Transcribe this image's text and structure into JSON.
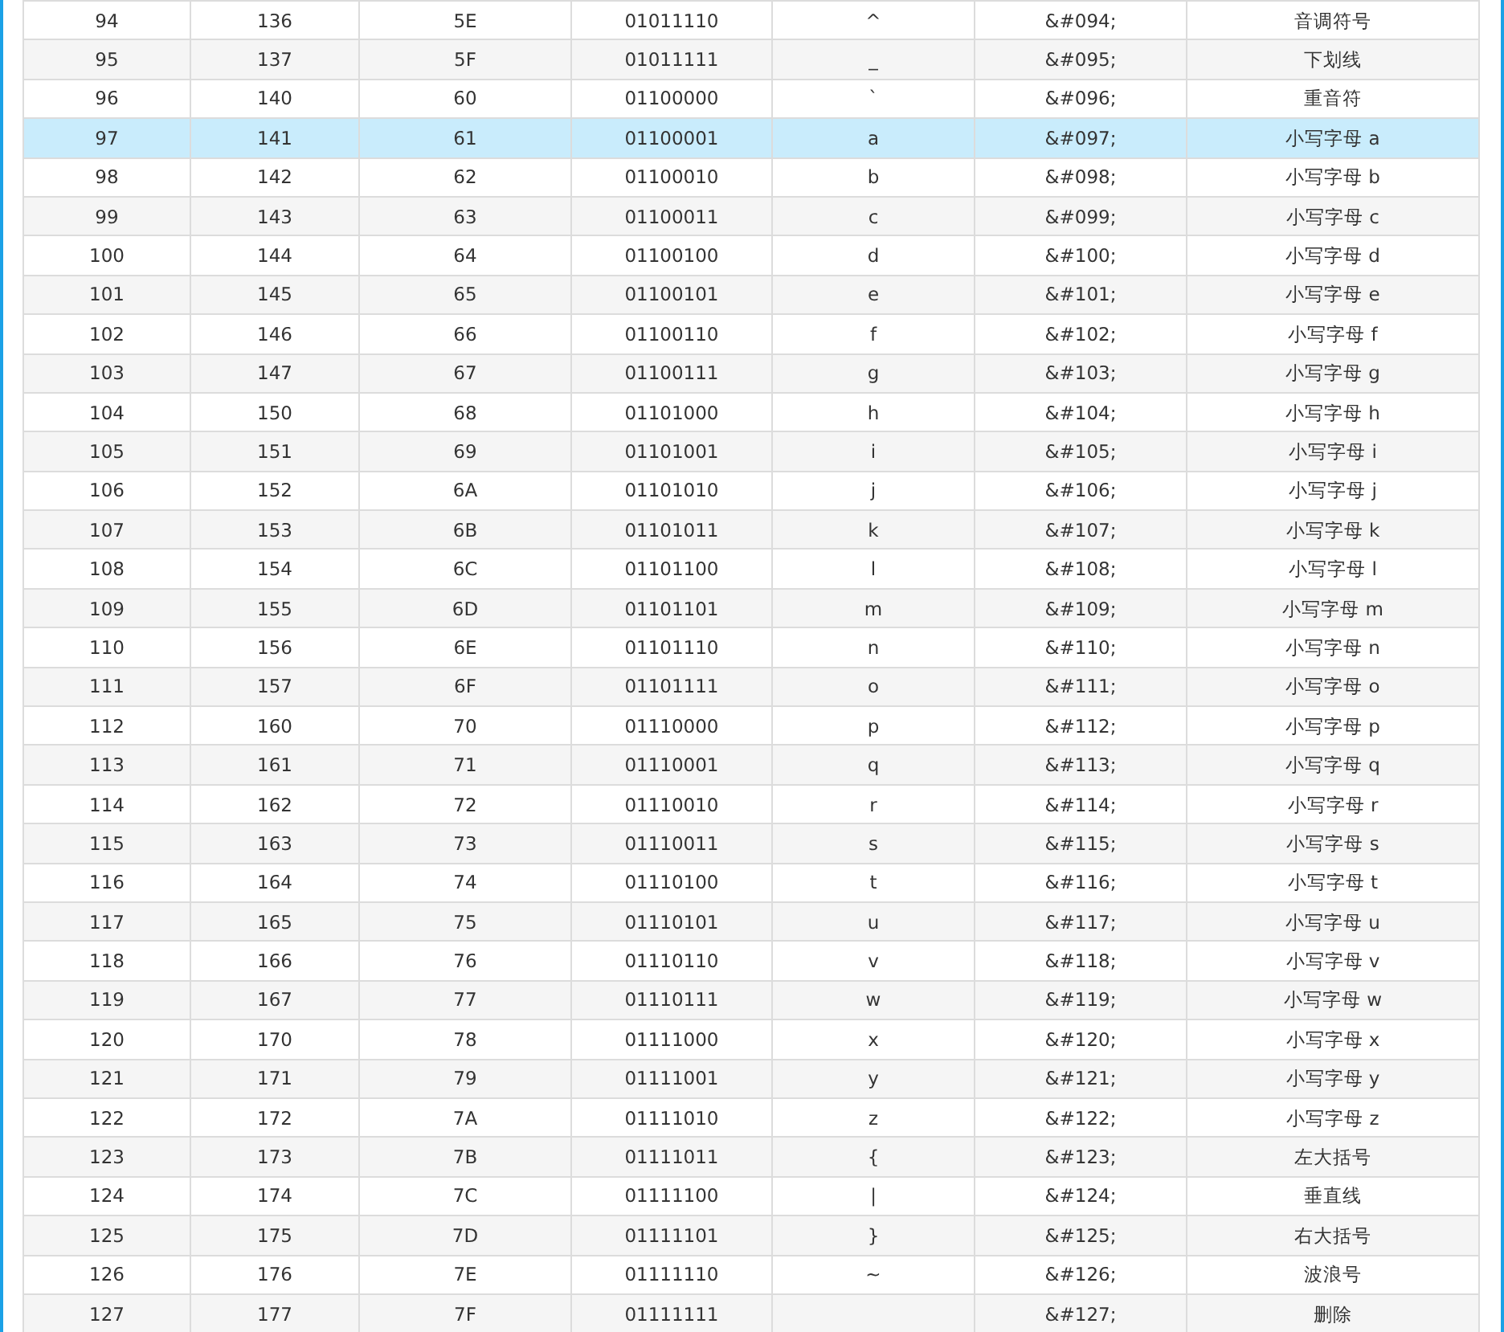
{
  "table": {
    "rows": [
      {
        "dec": "94",
        "oct": "136",
        "hex": "5E",
        "bin": "01011110",
        "char": "^",
        "entity": "&#094;",
        "desc": "音调符号",
        "selected": false
      },
      {
        "dec": "95",
        "oct": "137",
        "hex": "5F",
        "bin": "01011111",
        "char": "_",
        "entity": "&#095;",
        "desc": "下划线",
        "selected": false
      },
      {
        "dec": "96",
        "oct": "140",
        "hex": "60",
        "bin": "01100000",
        "char": "`",
        "entity": "&#096;",
        "desc": "重音符",
        "selected": false
      },
      {
        "dec": "97",
        "oct": "141",
        "hex": "61",
        "bin": "01100001",
        "char": "a",
        "entity": "&#097;",
        "desc": "小写字母 a",
        "selected": true
      },
      {
        "dec": "98",
        "oct": "142",
        "hex": "62",
        "bin": "01100010",
        "char": "b",
        "entity": "&#098;",
        "desc": "小写字母 b",
        "selected": false
      },
      {
        "dec": "99",
        "oct": "143",
        "hex": "63",
        "bin": "01100011",
        "char": "c",
        "entity": "&#099;",
        "desc": "小写字母 c",
        "selected": false
      },
      {
        "dec": "100",
        "oct": "144",
        "hex": "64",
        "bin": "01100100",
        "char": "d",
        "entity": "&#100;",
        "desc": "小写字母 d",
        "selected": false
      },
      {
        "dec": "101",
        "oct": "145",
        "hex": "65",
        "bin": "01100101",
        "char": "e",
        "entity": "&#101;",
        "desc": "小写字母 e",
        "selected": false
      },
      {
        "dec": "102",
        "oct": "146",
        "hex": "66",
        "bin": "01100110",
        "char": "f",
        "entity": "&#102;",
        "desc": "小写字母 f",
        "selected": false
      },
      {
        "dec": "103",
        "oct": "147",
        "hex": "67",
        "bin": "01100111",
        "char": "g",
        "entity": "&#103;",
        "desc": "小写字母 g",
        "selected": false
      },
      {
        "dec": "104",
        "oct": "150",
        "hex": "68",
        "bin": "01101000",
        "char": "h",
        "entity": "&#104;",
        "desc": "小写字母 h",
        "selected": false
      },
      {
        "dec": "105",
        "oct": "151",
        "hex": "69",
        "bin": "01101001",
        "char": "i",
        "entity": "&#105;",
        "desc": "小写字母 i",
        "selected": false
      },
      {
        "dec": "106",
        "oct": "152",
        "hex": "6A",
        "bin": "01101010",
        "char": "j",
        "entity": "&#106;",
        "desc": "小写字母 j",
        "selected": false
      },
      {
        "dec": "107",
        "oct": "153",
        "hex": "6B",
        "bin": "01101011",
        "char": "k",
        "entity": "&#107;",
        "desc": "小写字母 k",
        "selected": false
      },
      {
        "dec": "108",
        "oct": "154",
        "hex": "6C",
        "bin": "01101100",
        "char": "l",
        "entity": "&#108;",
        "desc": "小写字母 l",
        "selected": false
      },
      {
        "dec": "109",
        "oct": "155",
        "hex": "6D",
        "bin": "01101101",
        "char": "m",
        "entity": "&#109;",
        "desc": "小写字母 m",
        "selected": false
      },
      {
        "dec": "110",
        "oct": "156",
        "hex": "6E",
        "bin": "01101110",
        "char": "n",
        "entity": "&#110;",
        "desc": "小写字母 n",
        "selected": false
      },
      {
        "dec": "111",
        "oct": "157",
        "hex": "6F",
        "bin": "01101111",
        "char": "o",
        "entity": "&#111;",
        "desc": "小写字母 o",
        "selected": false
      },
      {
        "dec": "112",
        "oct": "160",
        "hex": "70",
        "bin": "01110000",
        "char": "p",
        "entity": "&#112;",
        "desc": "小写字母 p",
        "selected": false
      },
      {
        "dec": "113",
        "oct": "161",
        "hex": "71",
        "bin": "01110001",
        "char": "q",
        "entity": "&#113;",
        "desc": "小写字母 q",
        "selected": false
      },
      {
        "dec": "114",
        "oct": "162",
        "hex": "72",
        "bin": "01110010",
        "char": "r",
        "entity": "&#114;",
        "desc": "小写字母 r",
        "selected": false
      },
      {
        "dec": "115",
        "oct": "163",
        "hex": "73",
        "bin": "01110011",
        "char": "s",
        "entity": "&#115;",
        "desc": "小写字母 s",
        "selected": false
      },
      {
        "dec": "116",
        "oct": "164",
        "hex": "74",
        "bin": "01110100",
        "char": "t",
        "entity": "&#116;",
        "desc": "小写字母 t",
        "selected": false
      },
      {
        "dec": "117",
        "oct": "165",
        "hex": "75",
        "bin": "01110101",
        "char": "u",
        "entity": "&#117;",
        "desc": "小写字母 u",
        "selected": false
      },
      {
        "dec": "118",
        "oct": "166",
        "hex": "76",
        "bin": "01110110",
        "char": "v",
        "entity": "&#118;",
        "desc": "小写字母 v",
        "selected": false
      },
      {
        "dec": "119",
        "oct": "167",
        "hex": "77",
        "bin": "01110111",
        "char": "w",
        "entity": "&#119;",
        "desc": "小写字母 w",
        "selected": false
      },
      {
        "dec": "120",
        "oct": "170",
        "hex": "78",
        "bin": "01111000",
        "char": "x",
        "entity": "&#120;",
        "desc": "小写字母 x",
        "selected": false
      },
      {
        "dec": "121",
        "oct": "171",
        "hex": "79",
        "bin": "01111001",
        "char": "y",
        "entity": "&#121;",
        "desc": "小写字母 y",
        "selected": false
      },
      {
        "dec": "122",
        "oct": "172",
        "hex": "7A",
        "bin": "01111010",
        "char": "z",
        "entity": "&#122;",
        "desc": "小写字母 z",
        "selected": false
      },
      {
        "dec": "123",
        "oct": "173",
        "hex": "7B",
        "bin": "01111011",
        "char": "{",
        "entity": "&#123;",
        "desc": "左大括号",
        "selected": false
      },
      {
        "dec": "124",
        "oct": "174",
        "hex": "7C",
        "bin": "01111100",
        "char": "|",
        "entity": "&#124;",
        "desc": "垂直线",
        "selected": false
      },
      {
        "dec": "125",
        "oct": "175",
        "hex": "7D",
        "bin": "01111101",
        "char": "}",
        "entity": "&#125;",
        "desc": "右大括号",
        "selected": false
      },
      {
        "dec": "126",
        "oct": "176",
        "hex": "7E",
        "bin": "01111110",
        "char": "~",
        "entity": "&#126;",
        "desc": "波浪号",
        "selected": false
      },
      {
        "dec": "127",
        "oct": "177",
        "hex": "7F",
        "bin": "01111111",
        "entity": "&#127;",
        "desc": "删除",
        "selected": false
      }
    ]
  }
}
